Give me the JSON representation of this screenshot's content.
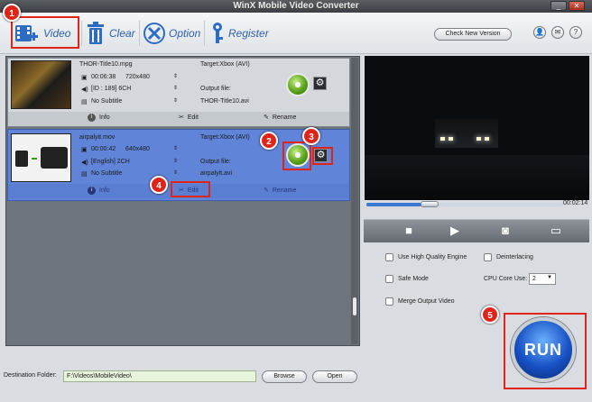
{
  "window": {
    "title": "WinX Mobile Video Converter",
    "controls": [
      "_",
      "✕"
    ]
  },
  "toolbar": {
    "video": "Video",
    "clear": "Clear",
    "option": "Option",
    "register": "Register",
    "check_version": "Check New Version",
    "circle_icons": [
      "👤",
      "✉",
      "?"
    ]
  },
  "files": [
    {
      "name": "THOR-Title10.mpg",
      "duration": "00:06:38",
      "resolution": "720x480",
      "audio": "[ID : 189] 6CH",
      "subtitle": "No Subtitle",
      "target": "Target:Xbox (AVI)",
      "output_label": "Output file:",
      "output": "THOR-Title10.avi",
      "selected": false
    },
    {
      "name": "airpalyit.mov",
      "duration": "00:00:42",
      "resolution": "640x480",
      "audio": "[English] 2CH",
      "subtitle": "No Subtitle",
      "target": "Target:Xbox (AVI)",
      "output_label": "Output file:",
      "output": "airpalyit.avi",
      "selected": true
    }
  ],
  "actions": {
    "info": "Info",
    "edit": "Edit",
    "rename": "Rename"
  },
  "preview": {
    "time": "00:02:14",
    "seek_progress": 0.28
  },
  "options": {
    "hq": "Use High Quality Engine",
    "deinterlace": "Deinterlacing",
    "safe": "Safe Mode",
    "core_label": "CPU Core Use:",
    "core_value": "2",
    "merge": "Merge Output Video"
  },
  "run": {
    "label": "RUN"
  },
  "destination": {
    "label": "Destination Folder:",
    "path": "F:\\Videos\\MobileVideo\\",
    "browse": "Browse",
    "open": "Open"
  },
  "badges": [
    "1",
    "2",
    "3",
    "4",
    "5"
  ],
  "colors": {
    "accent": "#2a5faa",
    "selected_row": "#5f84d8",
    "badge": "#e02418"
  }
}
